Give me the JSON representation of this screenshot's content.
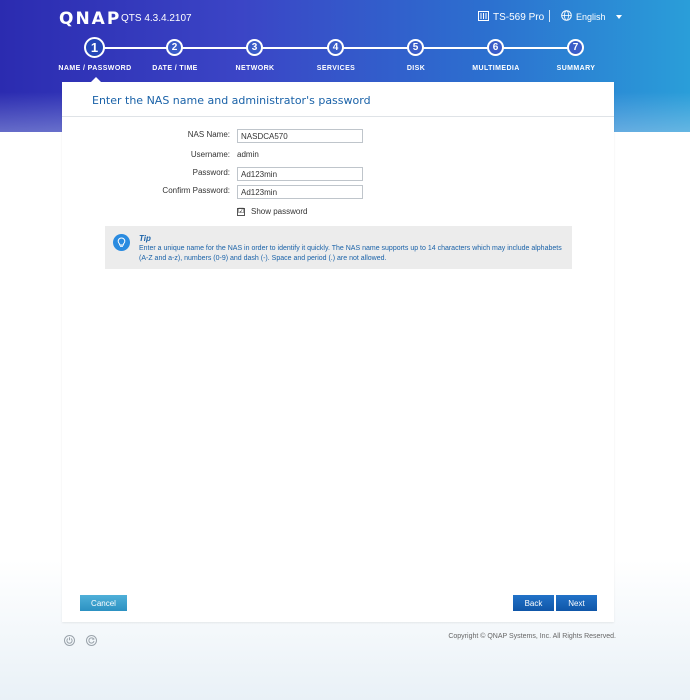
{
  "header": {
    "logo": "QNAP",
    "version": "QTS 4.3.4.2107",
    "model": "TS-569 Pro",
    "language": "English"
  },
  "steps": [
    {
      "number": "1",
      "label": "NAME / PASSWORD"
    },
    {
      "number": "2",
      "label": "DATE / TIME"
    },
    {
      "number": "3",
      "label": "NETWORK"
    },
    {
      "number": "4",
      "label": "SERVICES"
    },
    {
      "number": "5",
      "label": "DISK"
    },
    {
      "number": "6",
      "label": "MULTIMEDIA"
    },
    {
      "number": "7",
      "label": "SUMMARY"
    }
  ],
  "panel": {
    "title": "Enter the NAS name and administrator's password"
  },
  "form": {
    "nas_name_label": "NAS Name:",
    "nas_name_value": "NASDCA570",
    "username_label": "Username:",
    "username_value": "admin",
    "password_label": "Password:",
    "password_value": "Ad123min",
    "confirm_label": "Confirm Password:",
    "confirm_value": "Ad123min",
    "show_password_label": "Show password",
    "show_password_mark": "☑"
  },
  "tip": {
    "title": "Tip",
    "text": "Enter a unique name for the NAS in order to identify it quickly. The NAS name supports up to 14 characters which may include alphabets (A-Z and a-z), numbers (0-9) and dash (-). Space and period (.) are not allowed."
  },
  "buttons": {
    "cancel": "Cancel",
    "back": "Back",
    "next": "Next"
  },
  "footer": {
    "copyright": "Copyright © QNAP Systems, Inc. All Rights Reserved."
  }
}
